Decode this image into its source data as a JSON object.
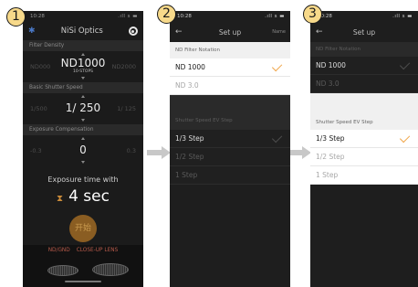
{
  "badges": [
    "1",
    "2",
    "3"
  ],
  "phone1": {
    "status_time": "10:28",
    "status_icons": ".ıll 𝗌 ▬",
    "title": "NiSi Optics",
    "back_icon": "bluetooth-icon",
    "filter_density": {
      "label": "Filter Density",
      "left": "ND000",
      "value": "ND1000",
      "sub": "10-STOPS",
      "right": "ND2000"
    },
    "shutter_speed": {
      "label": "Basic Shutter Speed",
      "left": "1/500",
      "value": "1/ 250",
      "right": "1/ 125"
    },
    "exposure_comp": {
      "label": "Exposure Compensation",
      "left": "-0.3",
      "value": "0",
      "right": "0.3"
    },
    "exposure_time_label": "Exposure time with",
    "exposure_time_value": "4 sec",
    "start_label": "开始",
    "bottom_tabs": [
      "ND/GND",
      "CLOSE-UP LENS"
    ]
  },
  "phone2": {
    "status_time": "10:28",
    "status_icons": ".ıll 𝗌 ▬",
    "title": "Set up",
    "nav_right": "Name",
    "nd_section": "ND Filter Notation",
    "nd_options": [
      {
        "label": "ND 1000",
        "selected": true
      },
      {
        "label": "ND 3.0",
        "selected": false
      }
    ],
    "ev_section": "Shutter Speed EV Step",
    "ev_options": [
      {
        "label": "1/3 Step",
        "selected": true
      },
      {
        "label": "1/2 Step",
        "selected": false
      },
      {
        "label": "1 Step",
        "selected": false
      }
    ]
  },
  "phone3": {
    "status_time": "10:28",
    "status_icons": ".ıll 𝗌 ▬",
    "title": "Set up",
    "nav_right": "",
    "nd_section": "ND Filter Notation",
    "nd_options": [
      {
        "label": "ND 1000",
        "selected": true
      },
      {
        "label": "ND 3.0",
        "selected": false
      }
    ],
    "ev_section": "Shutter Speed EV Step",
    "ev_options": [
      {
        "label": "1/3 Step",
        "selected": true
      },
      {
        "label": "1/2 Step",
        "selected": false
      },
      {
        "label": "1 Step",
        "selected": false
      }
    ]
  },
  "colors": {
    "badge": "#f7d98a",
    "accent_check": "#f0a64a",
    "start_button": "#8a5d22",
    "arrow": "#c8c8c8"
  }
}
